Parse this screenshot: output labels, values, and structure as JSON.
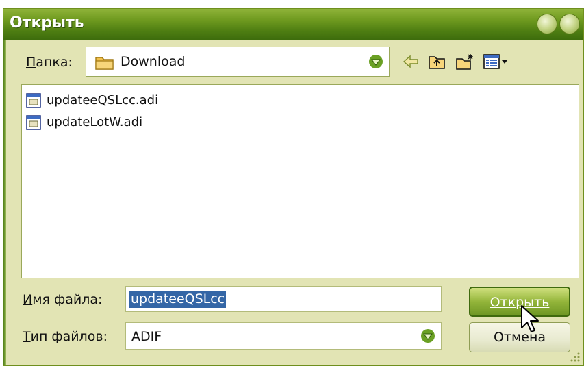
{
  "window": {
    "title": "Открыть"
  },
  "folder": {
    "label_accel": "П",
    "label_rest": "апка:",
    "current": "Download"
  },
  "files": [
    {
      "name": "updateeQSLcc.adi"
    },
    {
      "name": "updateLotW.adi"
    }
  ],
  "filename": {
    "label_accel": "И",
    "label_rest": "мя файла:",
    "value": "updateeQSLcc"
  },
  "filetype": {
    "label_accel": "Т",
    "label_rest": "ип файлов:",
    "value": "ADIF"
  },
  "buttons": {
    "open": "Открыть",
    "cancel": "Отмена"
  },
  "colors": {
    "titlebar": "#5d8c19",
    "dialog_bg": "#e2e4b4",
    "selection": "#3466a6",
    "accent_arrow": "#4f8a1a"
  },
  "icons": {
    "back": "back-arrow-icon",
    "up": "folder-up-icon",
    "new_folder": "new-folder-icon",
    "views": "view-menu-icon"
  }
}
